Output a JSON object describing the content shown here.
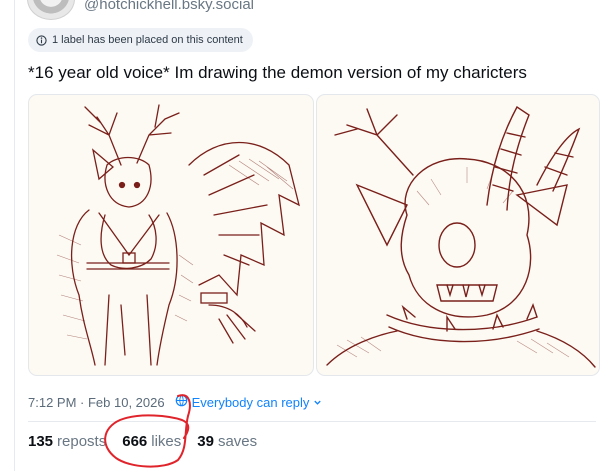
{
  "author": {
    "handle": "@hotchickhell.bsky.social"
  },
  "label_notice": "1 label has been placed on this content",
  "post": {
    "text": "*16 year old voice* Im drawing the demon version of my charicters"
  },
  "meta": {
    "timestamp": "7:12 PM · Feb 10, 2026",
    "reply_setting": "Everybody can reply"
  },
  "stats": {
    "reposts": {
      "count": "135",
      "label": "reposts"
    },
    "likes": {
      "count": "666",
      "label": "likes"
    },
    "saves": {
      "count": "39",
      "label": "saves"
    }
  },
  "colors": {
    "accent": "#1083fe",
    "ink": "#7a1f1a",
    "annotation": "#e0242b"
  },
  "icons": [
    "info-icon",
    "globe-icon",
    "chevron-down-icon"
  ]
}
